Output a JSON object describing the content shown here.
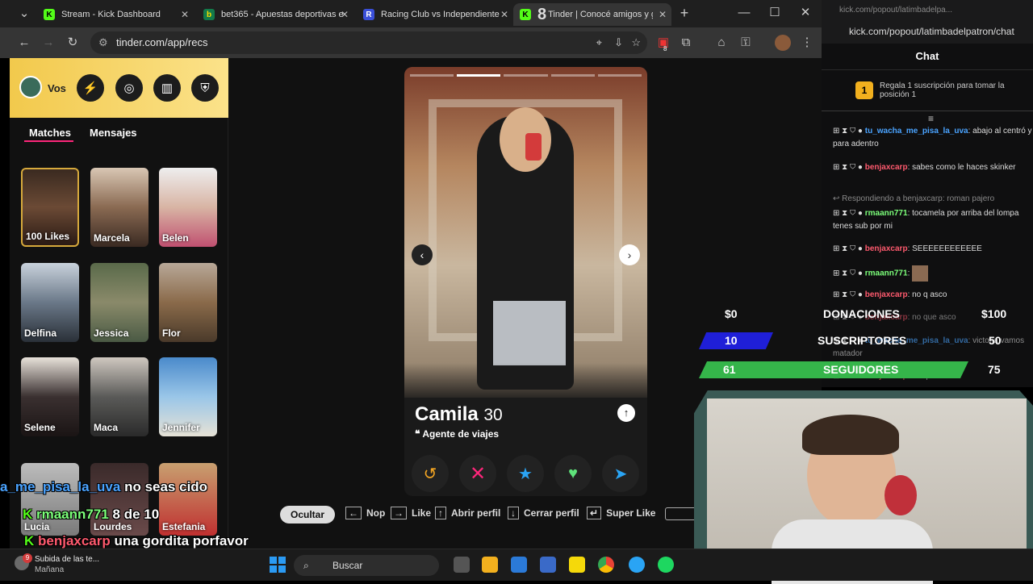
{
  "browser": {
    "tabs": [
      {
        "title": "Stream - Kick Dashboard",
        "favicon": "K"
      },
      {
        "title": "bet365 - Apuestas deportivas e",
        "favicon": "b"
      },
      {
        "title": "Racing Club vs Independiente",
        "favicon": "R"
      },
      {
        "title": "Tinder | Conocé amigos y gente",
        "favicon": "K"
      }
    ],
    "tab_badge": "8",
    "url": "tinder.com/app/recs",
    "ext_badge": "8"
  },
  "tinder": {
    "profile_label": "Vos",
    "tabs": {
      "matches": "Matches",
      "messages": "Mensajes"
    },
    "matches": [
      {
        "name": "100 Likes"
      },
      {
        "name": "Marcela"
      },
      {
        "name": "Belen"
      },
      {
        "name": "Delfina"
      },
      {
        "name": "Jessica"
      },
      {
        "name": "Flor"
      },
      {
        "name": "Selene"
      },
      {
        "name": "Maca"
      },
      {
        "name": "Jennifer"
      },
      {
        "name": "Lucia"
      },
      {
        "name": "Lourdes"
      },
      {
        "name": "Estefania"
      }
    ],
    "card": {
      "name": "Camila",
      "age": "30",
      "job": "Agente de viajes"
    },
    "shortcuts": [
      "Ocultar",
      "Nop",
      "Like",
      "Abrir perfil",
      "Cerrar perfil",
      "Super Like"
    ]
  },
  "chat": {
    "popout_url": "kick.com/popout/latimbadelpa...",
    "popout_url_full": "kick.com/popout/latimbadelpatron/chat",
    "title": "Chat",
    "gift_banner": "Regala 1 suscripción para tomar la posición 1",
    "gift_rank": "1",
    "messages": [
      {
        "user": "tu_wacha_me_pisa_la_uva",
        "text": ": abajo al centró y para adentro",
        "color": "#4aa3ff"
      },
      {
        "user": "benjaxcarp",
        "text": ": sabes como le haces skinker",
        "color": "#ff5a6e"
      },
      {
        "reply": "Respondiendo a benjaxcarp: roman pajero"
      },
      {
        "user": "rmaann771",
        "text": ": tocamela por arriba del lompa tenes sub por mi",
        "color": "#7cff7a"
      },
      {
        "user": "benjaxcarp",
        "text": ": SEEEEEEEEEEEE",
        "color": "#ff5a6e"
      },
      {
        "user": "rmaann771",
        "text": ":",
        "color": "#7cff7a"
      },
      {
        "user": "benjaxcarp",
        "text": ": no q asco",
        "color": "#ff5a6e"
      },
      {
        "user": "benjaxcarp",
        "text": ": no que asco",
        "color": "#ff5a6e"
      },
      {
        "user": "tu_wacha_me_pisa_la_uva",
        "text": ": victoria vamos matador",
        "color": "#4aa3ff"
      },
      {
        "user": "benjaxcarp",
        "text": ": no que asco",
        "color": "#ff5a6e"
      }
    ]
  },
  "stream_overlay": {
    "donaciones": {
      "current": "$0",
      "label": "DONACIONES",
      "goal": "$100"
    },
    "suscriptores": {
      "current": "10",
      "label": "SUSCRIPTORES",
      "goal": "50"
    },
    "seguidores": {
      "current": "61",
      "label": "SEGUIDORES",
      "goal": "75"
    },
    "chat_lines": [
      {
        "user": "a_me_pisa_la_uva",
        "text": "no seas cido",
        "color": "#4aa3ff"
      },
      {
        "user": "rmaann771",
        "text": "8 de 10",
        "color": "#7cff7a"
      },
      {
        "user": "benjaxcarp",
        "text": "una gordita porfavor",
        "color": "#ff5a6e"
      }
    ]
  },
  "taskbar": {
    "notification_title": "Subida de las te...",
    "notification_sub": "Mañana",
    "notification_badge": "9",
    "search": "Buscar"
  }
}
